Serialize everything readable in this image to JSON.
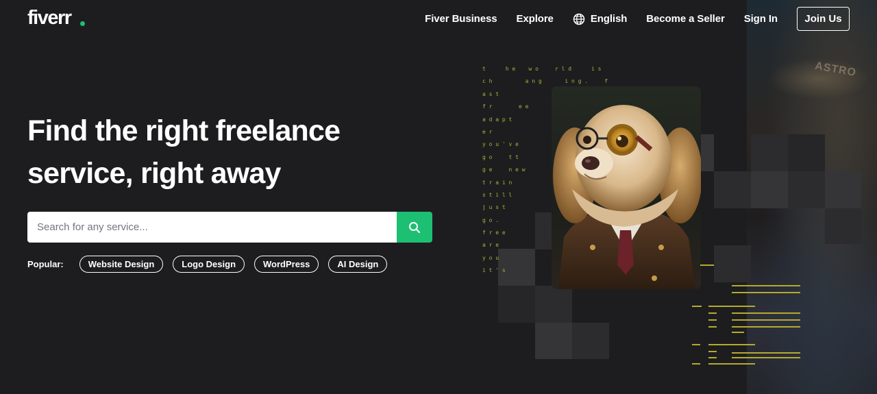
{
  "nav": {
    "logo": "fiverr",
    "links": [
      "Fiver Business",
      "Explore",
      "English",
      "Become a Seller",
      "Sign In"
    ],
    "join_label": "Join Us",
    "accent": "#1dbf73"
  },
  "hero": {
    "title_line1": "Find the right freelance",
    "title_line2": "service, right away",
    "search_placeholder": "Search for any service...",
    "popular_label": "Popular:",
    "popular_tags": [
      "Website Design",
      "Logo Design",
      "WordPress",
      "AI Design"
    ]
  },
  "art": {
    "code_lines": [
      "t      h e    w o     r l d      i s",
      "c h          a n g       i n g .     f",
      "a s t",
      "f r        e e",
      "a d a p t",
      "e r",
      "y o u ' v e",
      "g o     t t",
      "g e     n e w",
      "t r a i n",
      "s t i l l",
      "j u s t",
      "g o .",
      "f r e e",
      "a r e",
      "y o u",
      "i t ' s"
    ],
    "sign_text": "ASTRO"
  }
}
